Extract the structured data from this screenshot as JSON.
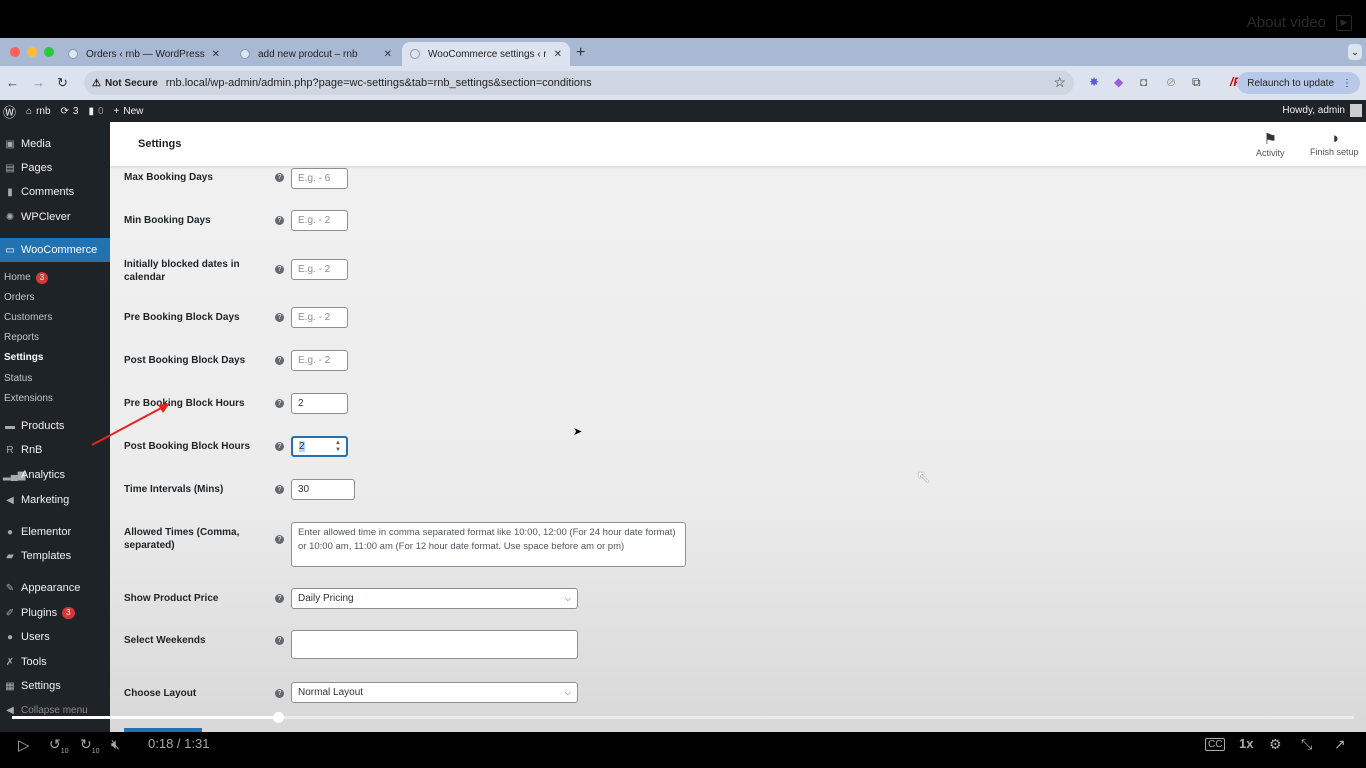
{
  "video_overlay": {
    "about_label": "About video"
  },
  "browser": {
    "tabs": [
      {
        "title": "Orders ‹ rnb — WordPress",
        "active": false
      },
      {
        "title": "add new prodcut – rnb",
        "active": false
      },
      {
        "title": "WooCommerce settings ‹ rnb",
        "active": true
      }
    ],
    "security_label": "Not Secure",
    "url": "rnb.local/wp-admin/admin.php?page=wc-settings&tab=rnb_settings&section=conditions",
    "relaunch_label": "Relaunch to update"
  },
  "admin_bar": {
    "site": "rnb",
    "updates": "3",
    "comments": "0",
    "new_label": "New",
    "howdy": "Howdy, admin"
  },
  "sidebar": {
    "items": [
      {
        "label": "Media",
        "icon": "media-icon"
      },
      {
        "label": "Pages",
        "icon": "pages-icon"
      },
      {
        "label": "Comments",
        "icon": "comments-icon"
      },
      {
        "label": "WPClever",
        "icon": "bulb-icon"
      },
      {
        "label": "WooCommerce",
        "icon": "woo-icon",
        "active": true
      },
      {
        "label": "Products",
        "icon": "products-icon"
      },
      {
        "label": "RnB",
        "icon": "rnb-icon"
      },
      {
        "label": "Analytics",
        "icon": "analytics-icon"
      },
      {
        "label": "Marketing",
        "icon": "megaphone-icon"
      },
      {
        "label": "Elementor",
        "icon": "elementor-icon"
      },
      {
        "label": "Templates",
        "icon": "folder-icon"
      },
      {
        "label": "Appearance",
        "icon": "brush-icon"
      },
      {
        "label": "Plugins",
        "icon": "plugin-icon",
        "badge": "3"
      },
      {
        "label": "Users",
        "icon": "user-icon"
      },
      {
        "label": "Tools",
        "icon": "wrench-icon"
      },
      {
        "label": "Settings",
        "icon": "settings-icon"
      }
    ],
    "woo_sub": [
      {
        "label": "Home",
        "badge": "3"
      },
      {
        "label": "Orders"
      },
      {
        "label": "Customers"
      },
      {
        "label": "Reports"
      },
      {
        "label": "Settings",
        "current": true
      },
      {
        "label": "Status"
      },
      {
        "label": "Extensions"
      }
    ],
    "collapse_label": "Collapse menu"
  },
  "header": {
    "title": "Settings",
    "activity_label": "Activity",
    "finish_label": "Finish setup"
  },
  "form": {
    "fields": [
      {
        "label": "Max Booking Days",
        "placeholder": "E.g. - 6",
        "value": ""
      },
      {
        "label": "Min Booking Days",
        "placeholder": "E.g. - 2",
        "value": ""
      },
      {
        "label": "Initially blocked dates in calendar",
        "placeholder": "E.g. - 2",
        "value": ""
      },
      {
        "label": "Pre Booking Block Days",
        "placeholder": "E.g. - 2",
        "value": ""
      },
      {
        "label": "Post Booking Block Days",
        "placeholder": "E.g. - 2",
        "value": ""
      },
      {
        "label": "Pre Booking Block Hours",
        "placeholder": "",
        "value": "2"
      },
      {
        "label": "Post Booking Block Hours",
        "placeholder": "",
        "value": "2"
      },
      {
        "label": "Time Intervals (Mins)",
        "placeholder": "",
        "value": "30"
      },
      {
        "label": "Allowed Times (Comma, separated)",
        "placeholder": "Enter allowed time in comma separated format like 10:00, 12:00 (For 24 hour date format) or 10:00 am, 11:00 am (For 12 hour date format. Use space before am or pm)",
        "value": ""
      },
      {
        "label": "Show Product Price",
        "value": "Daily Pricing"
      },
      {
        "label": "Select Weekends",
        "value": ""
      },
      {
        "label": "Choose Layout",
        "value": "Normal Layout"
      }
    ]
  },
  "player": {
    "time": "0:18 / 1:31",
    "progress": 0.198,
    "speed": "1x",
    "rewind": "10",
    "forward": "10"
  }
}
